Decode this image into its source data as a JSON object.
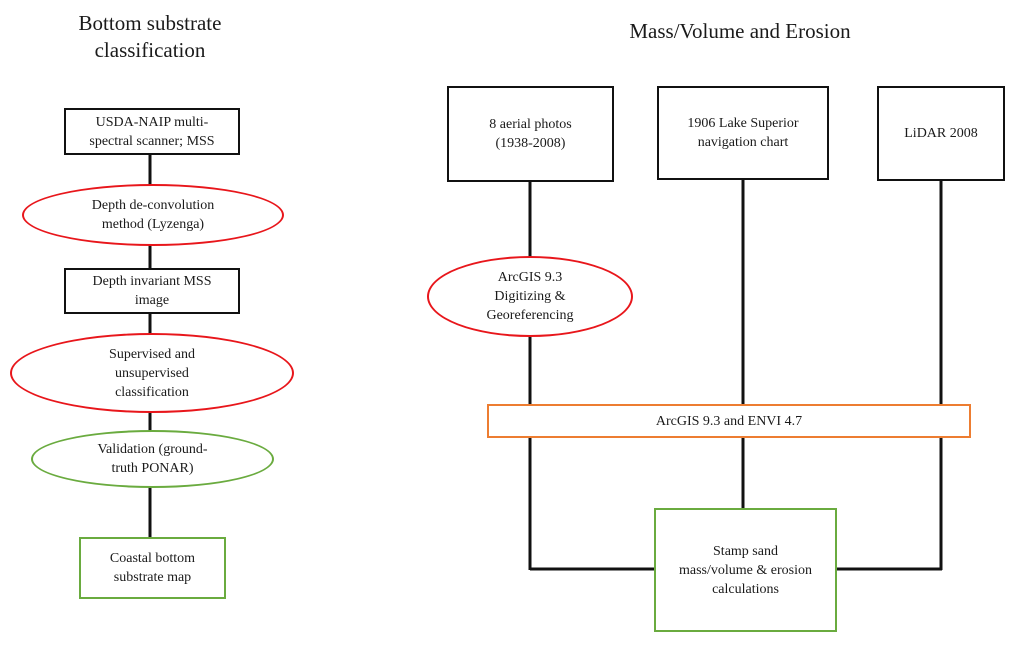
{
  "colors": {
    "connector": "#111111",
    "data_source_border": "#111111",
    "process_border": "#e8161b",
    "validation_border": "#6aab3f",
    "output_border": "#6aab3f",
    "software_border": "#ed7d31"
  },
  "left_panel": {
    "title": "Bottom substrate\nclassification",
    "nodes": [
      {
        "id": "usda-naip",
        "shape": "rectangle",
        "text": "USDA-NAIP multi-\nspectral scanner; MSS"
      },
      {
        "id": "depth-deconvolution",
        "shape": "ellipse",
        "text": "Depth de-convolution\nmethod (Lyzenga)"
      },
      {
        "id": "depth-invariant",
        "shape": "rectangle",
        "text": "Depth invariant MSS\nimage"
      },
      {
        "id": "classification",
        "shape": "ellipse",
        "text": "Supervised and\nunsupervised\nclassification"
      },
      {
        "id": "validation",
        "shape": "ellipse",
        "text": "Validation (ground-\ntruth PONAR)"
      },
      {
        "id": "substrate-map",
        "shape": "rectangle",
        "text": "Coastal bottom\nsubstrate map"
      }
    ]
  },
  "right_panel": {
    "title": "Mass/Volume and Erosion",
    "sources": [
      {
        "id": "aerial-photos",
        "text": "8 aerial photos\n(1938-2008)"
      },
      {
        "id": "nav-chart",
        "text": "1906 Lake Superior\nnavigation chart"
      },
      {
        "id": "lidar",
        "text": "LiDAR 2008"
      }
    ],
    "digitizing": {
      "text": "ArcGIS 9.3\nDigitizing &\nGeoreferencing"
    },
    "software_bar": {
      "text": "ArcGIS 9.3 and ENVI 4.7"
    },
    "output": {
      "text": "Stamp sand\nmass/volume & erosion\ncalculations"
    }
  }
}
